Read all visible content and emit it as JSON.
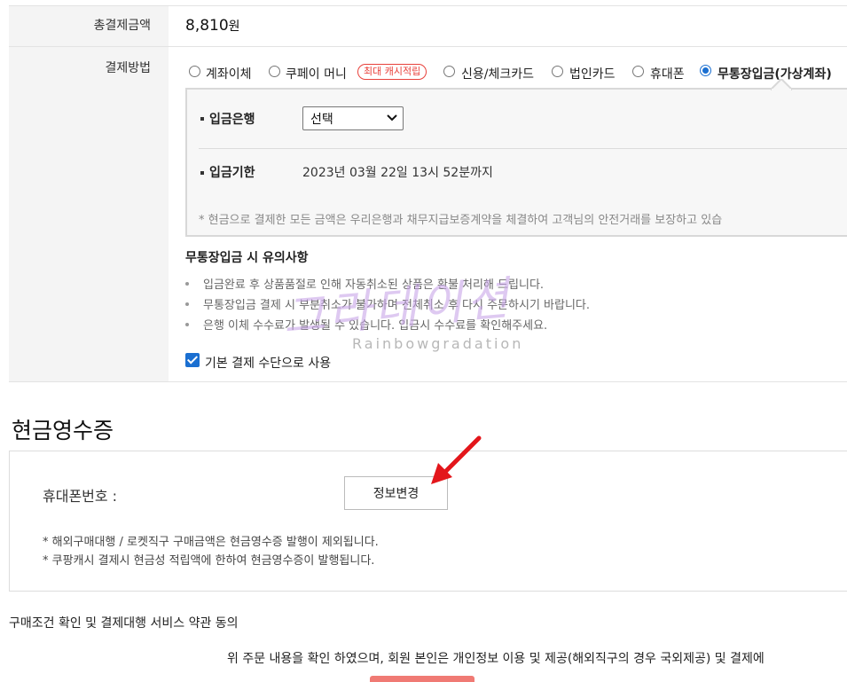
{
  "payment_summary": {
    "total_label": "총결제금액",
    "total_value": "8,810",
    "total_unit": "원"
  },
  "payment_method": {
    "label": "결제방법",
    "options": [
      {
        "label": "계좌이체",
        "selected": false
      },
      {
        "label": "쿠페이 머니",
        "selected": false
      },
      {
        "label": "신용/체크카드",
        "selected": false
      },
      {
        "label": "법인카드",
        "selected": false
      },
      {
        "label": "휴대폰",
        "selected": false
      },
      {
        "label": "무통장입금(가상계좌)",
        "selected": true
      }
    ],
    "badge": "최대 캐시적립"
  },
  "bank_transfer": {
    "bank_label": "입금은행",
    "bank_select_value": "선택",
    "deadline_label": "입금기한",
    "deadline_value": "2023년 03월 22일 13시 52분까지",
    "guarantee_note": "* 현금으로 결제한 모든 금액은 우리은행과 채무지급보증계약을 체결하여 고객님의 안전거래를 보장하고 있습"
  },
  "notice": {
    "title": "무통장입금 시 유의사항",
    "items": [
      "입금완료 후 상품품절로 인해 자동취소된 상품은 환불 처리해 드립니다.",
      "무통장입금 결제 시 부분취소가 불가하며 전체취소 후 다시 주문하시기 바랍니다.",
      "은행 이체 수수료가 발생될 수 있습니다. 입금시 수수료를 확인해주세요."
    ]
  },
  "default_payment": {
    "label": "기본 결제 수단으로 사용",
    "checked": true
  },
  "cash_receipt": {
    "title": "현금영수증",
    "phone_label": "휴대폰번호 :",
    "change_button": "정보변경",
    "notes": [
      "* 해외구매대행 / 로켓직구 구매금액은 현금영수증 발행이 제외됩니다.",
      "* 쿠팡캐시 결제시 현금성 적립액에 한하여 현금영수증이 발행됩니다."
    ]
  },
  "terms": {
    "title": "구매조건 확인 및 결제대행 서비스 약관 동의",
    "text": "위 주문 내용을 확인 하였으며, 회원 본인은 개인정보 이용 및 제공(해외직구의 경우 국외제공) 및 결제에"
  },
  "watermark": {
    "script_text": "그라데이션",
    "sub_text": "Rainbowgradation"
  },
  "colors": {
    "accent": "#1a6fd1",
    "badge": "#e8413b",
    "arrow": "#e3161b",
    "pay_button": "#f07a74"
  }
}
